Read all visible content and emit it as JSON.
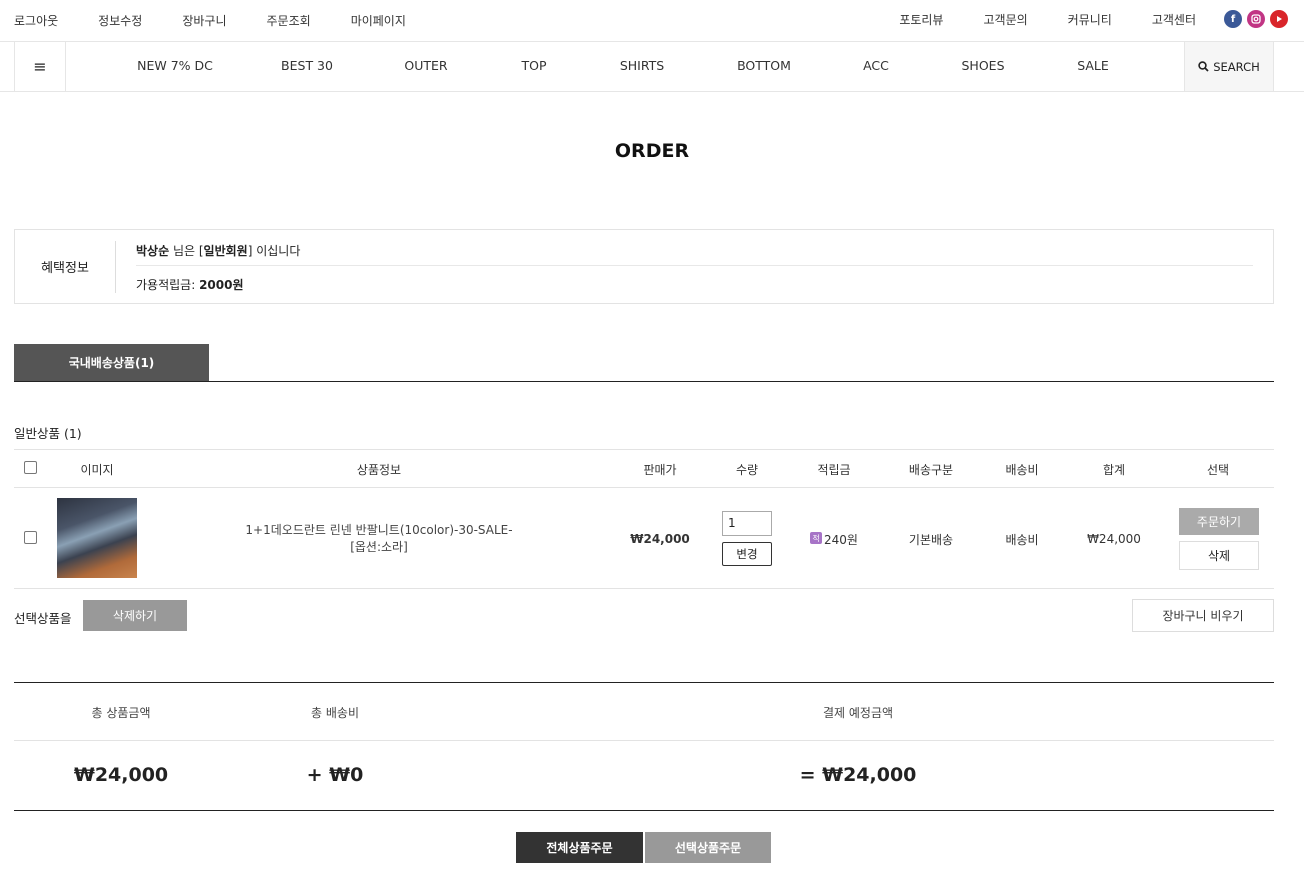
{
  "topbar": {
    "left": [
      "로그아웃",
      "정보수정",
      "장바구니",
      "주문조회",
      "마이페이지"
    ],
    "right": [
      "포토리뷰",
      "고객문의",
      "커뮤니티",
      "고객센터"
    ],
    "sns": [
      "facebook-icon",
      "instagram-icon",
      "youtube-icon"
    ]
  },
  "nav": {
    "menu_icon": "≡",
    "items": [
      "NEW 7% DC",
      "BEST 30",
      "OUTER",
      "TOP",
      "SHIRTS",
      "BOTTOM",
      "ACC",
      "SHOES",
      "SALE"
    ],
    "search_label": "SEARCH"
  },
  "page_title": "ORDER",
  "benefit": {
    "label": "혜택정보",
    "name": "박상순",
    "mid": " 님은 [",
    "grade": "일반회원",
    "tail": "] 이십니다",
    "points_label": "가용적립금: ",
    "points_value": "2000원"
  },
  "tab": {
    "label": "국내배송상품(1)"
  },
  "group_label": "일반상품 (1)",
  "table": {
    "headers": [
      "이미지",
      "상품정보",
      "판매가",
      "수량",
      "적립금",
      "배송구분",
      "배송비",
      "합계",
      "선택"
    ],
    "row": {
      "name_line1": "1+1데오드란트 린넨 반팔니트(10color)-30-SALE-",
      "name_line2": "[옵션:소라]",
      "price": "₩24,000",
      "qty": "1",
      "change_label": "변경",
      "point_badge": "적",
      "points": "240원",
      "shipping_type": "기본배송",
      "shipping_fee": "배송비",
      "total": "₩24,000",
      "order_label": "주문하기",
      "delete_label": "삭제"
    }
  },
  "selection": {
    "label": "선택상품을",
    "delete_label": "삭제하기",
    "empty_cart_label": "장바구니 비우기"
  },
  "summary": {
    "total_products_label": "총 상품금액",
    "total_shipping_label": "총 배송비",
    "payment_label": "결제 예정금액",
    "total_products": "₩24,000",
    "total_shipping": "+ ₩0",
    "payment": "= ₩24,000"
  },
  "actions": {
    "order_all": "전체상품주문",
    "order_selected": "선택상품주문"
  }
}
